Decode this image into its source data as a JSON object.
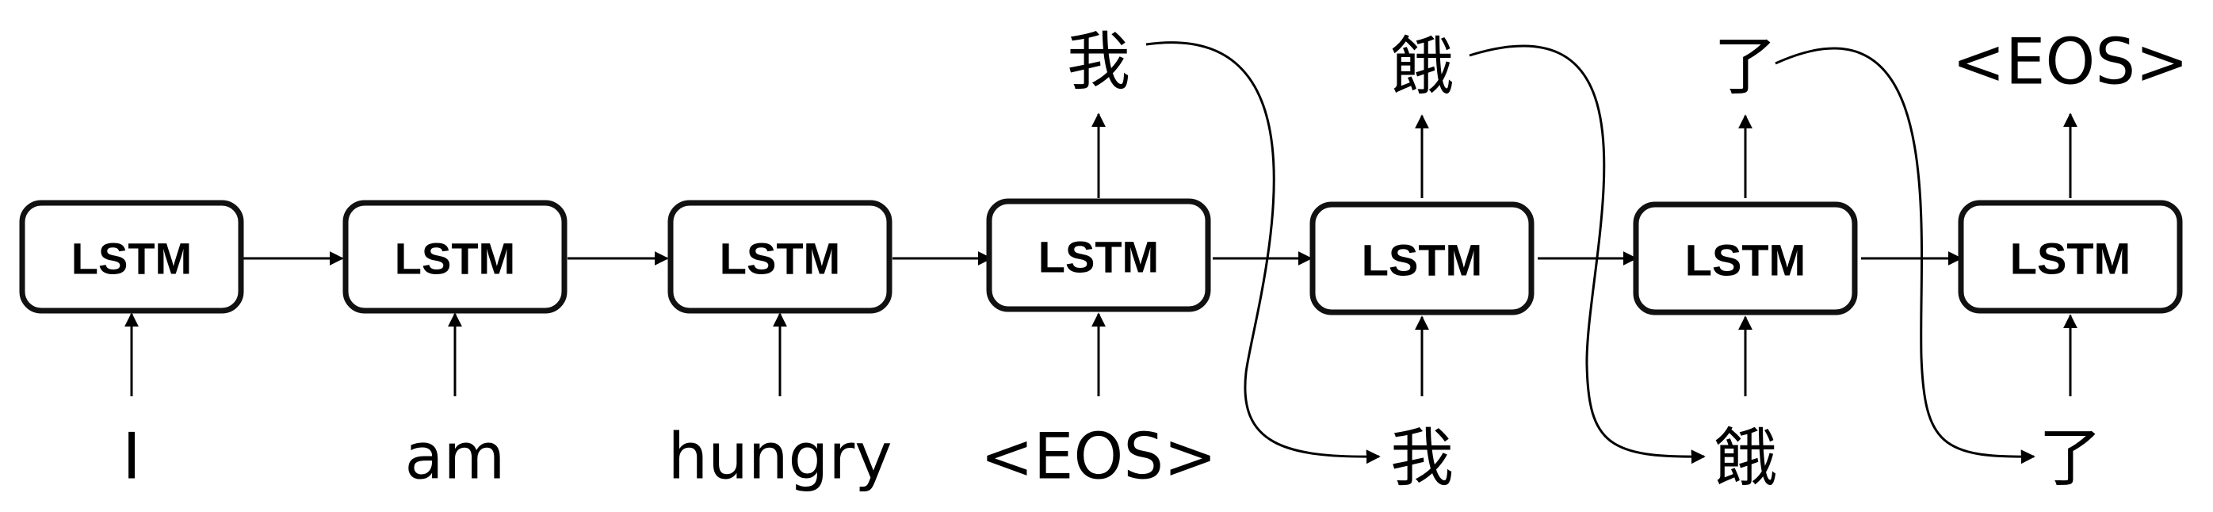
{
  "cells": [
    {
      "label": "LSTM"
    },
    {
      "label": "LSTM"
    },
    {
      "label": "LSTM"
    },
    {
      "label": "LSTM"
    },
    {
      "label": "LSTM"
    },
    {
      "label": "LSTM"
    },
    {
      "label": "LSTM"
    }
  ],
  "inputs": [
    "I",
    "am",
    "hungry",
    "<EOS>",
    "我",
    "餓",
    "了"
  ],
  "outputs": [
    "我",
    "餓",
    "了",
    "<EOS>"
  ]
}
